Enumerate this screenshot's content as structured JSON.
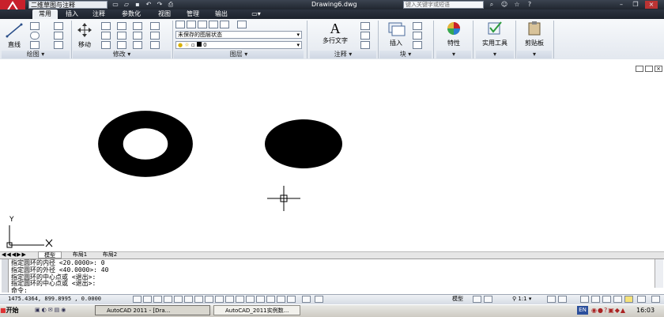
{
  "titlebar": {
    "workspace": "二维草图与注释",
    "doc_title": "Drawing6.dwg",
    "search_placeholder": "键入关键字或短语"
  },
  "ribbon_tabs": [
    "常用",
    "插入",
    "注释",
    "参数化",
    "视图",
    "管理",
    "输出"
  ],
  "ribbon": {
    "draw": {
      "line_label": "直线",
      "panel_title": "绘图"
    },
    "modify": {
      "move_label": "移动",
      "panel_title": "修改"
    },
    "layers": {
      "state": "未保存的图层状态",
      "current_layer": "0",
      "panel_title": "图层"
    },
    "annotation": {
      "mtext_label": "多行文字",
      "panel_title": "注释"
    },
    "block": {
      "insert_label": "插入",
      "panel_title": "块"
    },
    "properties": {
      "label": "特性"
    },
    "utilities": {
      "label": "实用工具"
    },
    "clipboard": {
      "label": "剪贴板"
    }
  },
  "drawing": {
    "ucs_y_label": "Y"
  },
  "layout_tabs": [
    "模型",
    "布局1",
    "布局2"
  ],
  "command_history": [
    "指定圆环的内径 <20.0000>: 0",
    "指定圆环的外径 <40.0000>: 40",
    "指定圆环的中心点或 <退出>:",
    "指定圆环的中心点或 <退出>:"
  ],
  "command_prompt": "命令:",
  "status": {
    "coordinates": "1475.4364, 899.8995 , 0.0000",
    "model_label": "模型",
    "annotation_scale": "1:1"
  },
  "taskbar": {
    "start_label": "开始",
    "tasks": [
      "AutoCAD 2011 - [Dra...",
      "AutoCAD_2011实例数..."
    ],
    "lang": "EN",
    "clock": "16:03"
  },
  "colors": {
    "titlebar": "#20262f",
    "ribbon": "#e3e8ef",
    "accent": "#c8202b"
  }
}
